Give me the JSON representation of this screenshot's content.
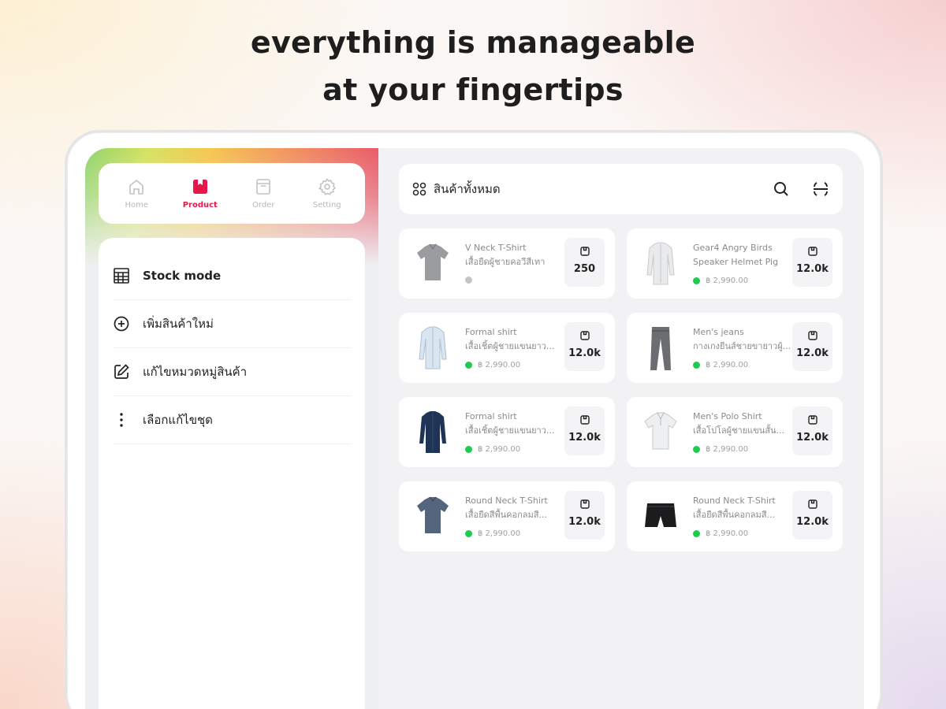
{
  "headline": {
    "line1": "everything is manageable",
    "line2": "at your fingertips"
  },
  "tabs": [
    {
      "label": "Home",
      "icon": "home-icon",
      "active": false
    },
    {
      "label": "Product",
      "icon": "product-icon",
      "active": true
    },
    {
      "label": "Order",
      "icon": "order-icon",
      "active": false
    },
    {
      "label": "Setting",
      "icon": "gear-icon",
      "active": false
    }
  ],
  "menu": [
    {
      "label": "Stock mode",
      "icon": "stock-grid-icon"
    },
    {
      "label": "เพิ่มสินค้าใหม่",
      "icon": "plus-circle-icon"
    },
    {
      "label": "แก้ไขหมวดหมู่สินค้า",
      "icon": "edit-icon"
    },
    {
      "label": "เลือกแก้ไขชุด",
      "icon": "more-vertical-icon"
    }
  ],
  "topbar": {
    "title": "สินค้าทั้งหมด",
    "icons": [
      "grid-icon",
      "search-icon",
      "scan-icon"
    ]
  },
  "products": [
    {
      "name1": "V Neck T-Shirt",
      "name2": "เสื้อยืดผู้ชายคอวีสีเทา",
      "price": "",
      "stock": "250",
      "status": "inactive",
      "image": "tshirt-grey"
    },
    {
      "name1": "Gear4 Angry Birds",
      "name2": "Speaker Helmet Pig",
      "price": "฿ 2,990.00",
      "stock": "12.0k",
      "status": "active",
      "image": "shirt-white-longsleeve"
    },
    {
      "name1": "Formal shirt",
      "name2": "เสื้อเชิ้ตผู้ชายแขนยาว...",
      "price": "฿ 2,990.00",
      "stock": "12.0k",
      "status": "active",
      "image": "shirt-lightblue"
    },
    {
      "name1": "Men's jeans",
      "name2": "กางเกงยีนส์ชายขายาวผู้...",
      "price": "฿ 2,990.00",
      "stock": "12.0k",
      "status": "active",
      "image": "jeans-grey"
    },
    {
      "name1": "Formal shirt",
      "name2": "เสื้อเชิ้ตผู้ชายแขนยาว...",
      "price": "฿ 2,990.00",
      "stock": "12.0k",
      "status": "active",
      "image": "shirt-navy"
    },
    {
      "name1": "Men's Polo Shirt",
      "name2": "เสื้อโปโลผู้ชายแขนสั้น...",
      "price": "฿ 2,990.00",
      "stock": "12.0k",
      "status": "active",
      "image": "polo-white"
    },
    {
      "name1": "Round Neck T-Shirt",
      "name2": "เสื้อยืดสีพื้นคอกลมสี...",
      "price": "฿ 2,990.00",
      "stock": "12.0k",
      "status": "active",
      "image": "tshirt-slate"
    },
    {
      "name1": "Round Neck T-Shirt",
      "name2": "เสื้อยืดสีพื้นคอกลมสี...",
      "price": "฿ 2,990.00",
      "stock": "12.0k",
      "status": "active",
      "image": "shorts-black"
    }
  ],
  "colors": {
    "accent": "#e8174a",
    "status_active": "#1fcb4f",
    "status_inactive": "#c4c4c8"
  }
}
